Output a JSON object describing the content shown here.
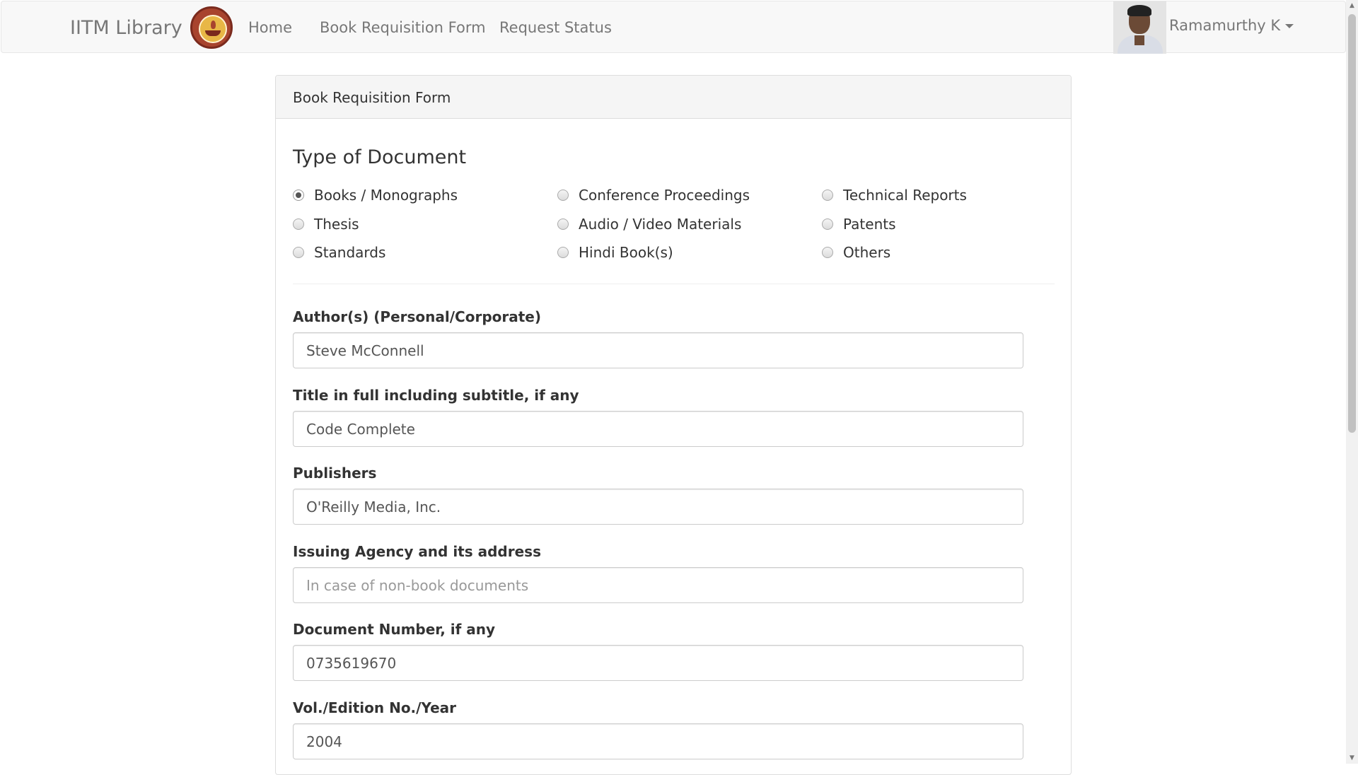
{
  "navbar": {
    "brand": "IITM Library",
    "logo_icon": "iitm-emblem-icon",
    "links": [
      {
        "label": "Home"
      },
      {
        "label": "Book Requisition Form"
      },
      {
        "label": "Request Status"
      }
    ],
    "user": {
      "name": "Ramamurthy K",
      "avatar": "user-photo"
    }
  },
  "form": {
    "panel_title": "Book Requisition Form",
    "section_title": "Type of Document",
    "document_types": [
      {
        "label": "Books / Monographs",
        "checked": true
      },
      {
        "label": "Conference Proceedings",
        "checked": false
      },
      {
        "label": "Technical Reports",
        "checked": false
      },
      {
        "label": "Thesis",
        "checked": false
      },
      {
        "label": "Audio / Video Materials",
        "checked": false
      },
      {
        "label": "Patents",
        "checked": false
      },
      {
        "label": "Standards",
        "checked": false
      },
      {
        "label": "Hindi Book(s)",
        "checked": false
      },
      {
        "label": "Others",
        "checked": false
      }
    ],
    "fields": [
      {
        "label": "Author(s) (Personal/Corporate)",
        "value": "Steve McConnell",
        "placeholder": ""
      },
      {
        "label": "Title in full including subtitle, if any",
        "value": "Code Complete",
        "placeholder": ""
      },
      {
        "label": "Publishers",
        "value": "O'Reilly Media, Inc.",
        "placeholder": ""
      },
      {
        "label": "Issuing Agency and its address",
        "value": "",
        "placeholder": "In case of non-book documents"
      },
      {
        "label": "Document Number, if any",
        "value": "0735619670",
        "placeholder": ""
      },
      {
        "label": "Vol./Edition No./Year",
        "value": "2004",
        "placeholder": ""
      }
    ]
  }
}
